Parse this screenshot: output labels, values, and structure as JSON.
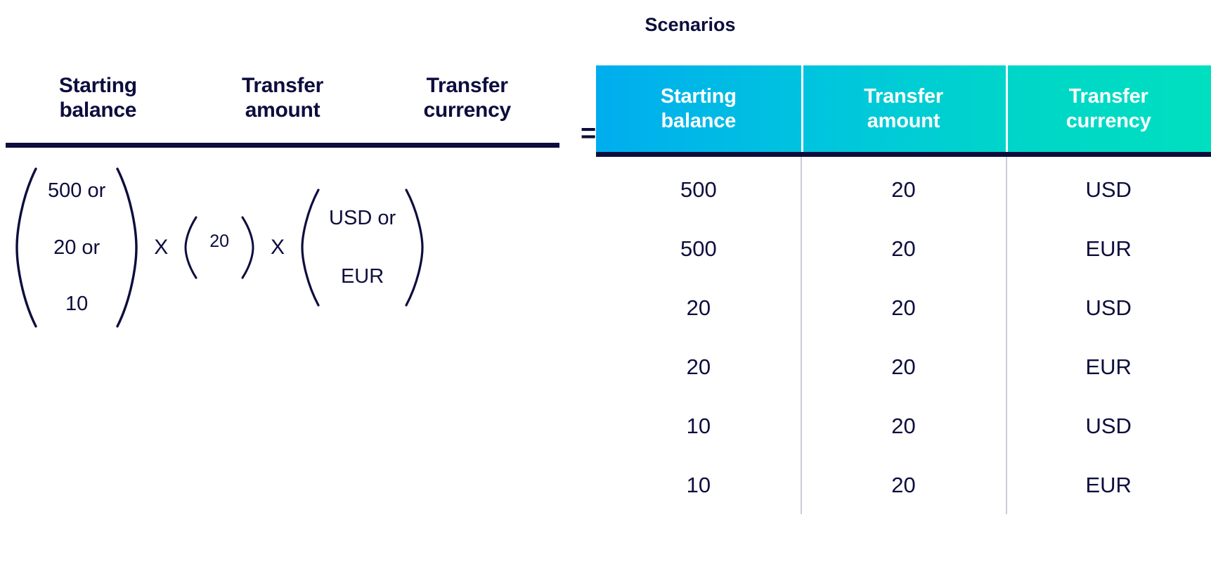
{
  "formula": {
    "headers": [
      {
        "line1": "Starting",
        "line2": "balance"
      },
      {
        "line1": "Transfer",
        "line2": "amount"
      },
      {
        "line1": "Transfer",
        "line2": "currency"
      }
    ],
    "equals": "=",
    "multiply_symbol": "X",
    "groups": [
      {
        "name": "starting-balance",
        "items": [
          "500 or",
          "20 or",
          "10"
        ]
      },
      {
        "name": "transfer-amount",
        "items": [
          "20"
        ]
      },
      {
        "name": "transfer-currency",
        "items": [
          "USD or",
          "EUR"
        ]
      }
    ]
  },
  "scenarios": {
    "title": "Scenarios",
    "columns": [
      {
        "line1": "Starting",
        "line2": "balance"
      },
      {
        "line1": "Transfer",
        "line2": "amount"
      },
      {
        "line1": "Transfer",
        "line2": "currency"
      }
    ],
    "rows": [
      {
        "starting_balance": "500",
        "transfer_amount": "20",
        "transfer_currency": "USD"
      },
      {
        "starting_balance": "500",
        "transfer_amount": "20",
        "transfer_currency": "EUR"
      },
      {
        "starting_balance": "20",
        "transfer_amount": "20",
        "transfer_currency": "USD"
      },
      {
        "starting_balance": "20",
        "transfer_amount": "20",
        "transfer_currency": "EUR"
      },
      {
        "starting_balance": "10",
        "transfer_amount": "20",
        "transfer_currency": "USD"
      },
      {
        "starting_balance": "10",
        "transfer_amount": "20",
        "transfer_currency": "EUR"
      }
    ]
  },
  "colors": {
    "ink": "#0d0d3d",
    "header_gradient_start": "#00adee",
    "header_gradient_end": "#00dfc0",
    "divider": "#c9ccd6",
    "header_text": "#ffffff"
  }
}
